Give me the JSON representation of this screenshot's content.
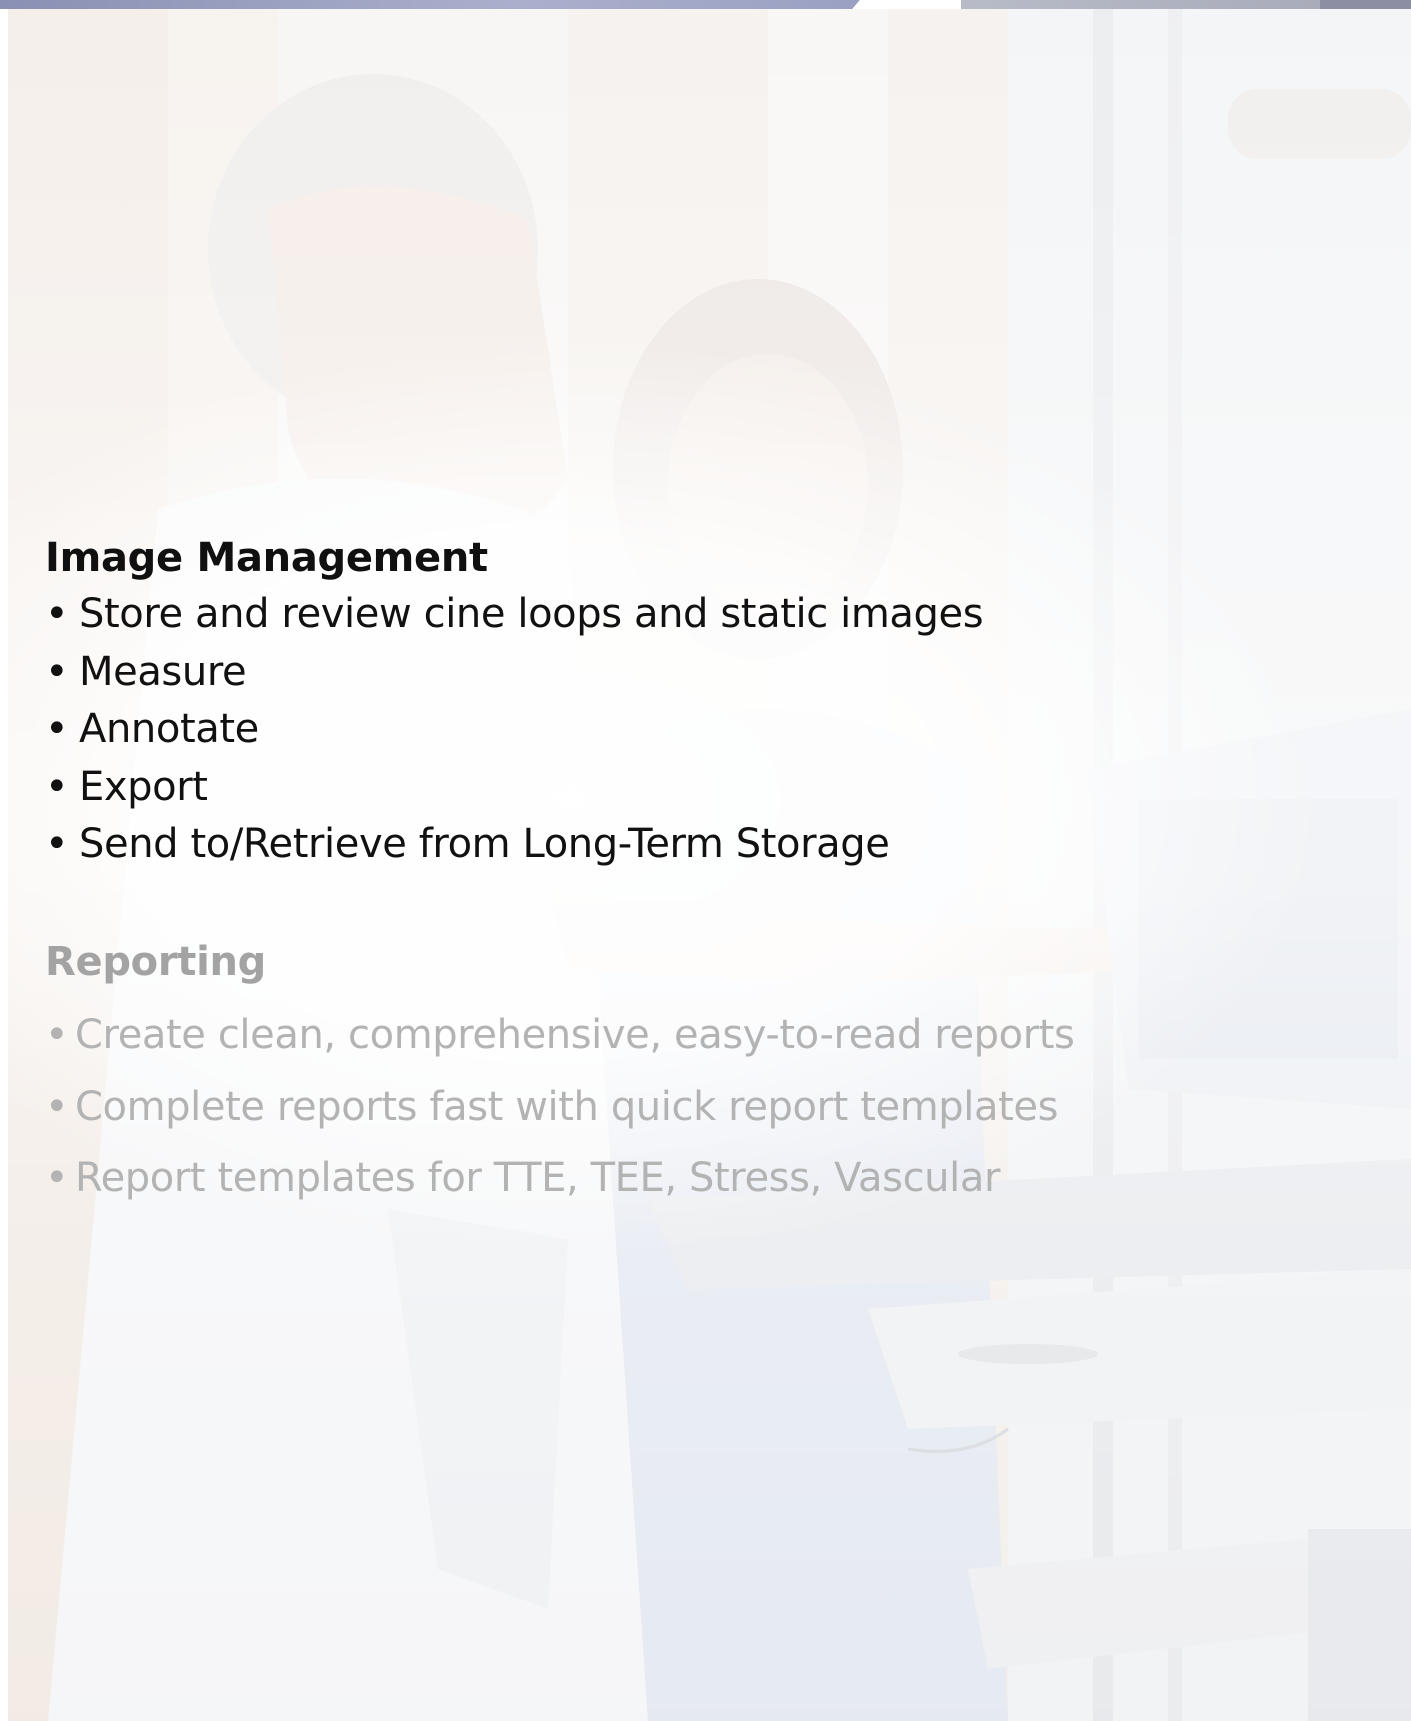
{
  "colors": {
    "top_strip_left": "#9aa0c2",
    "top_strip_right": "#a9acba",
    "heading_dark": "#101010",
    "text_dark": "#111111",
    "heading_faded": "#a3a3a3",
    "text_faded": "#b3b3b3"
  },
  "bullet_glyph": "•",
  "image_management": {
    "title": "Image Management",
    "items": [
      "Store and review cine loops and static images",
      "Measure",
      "Annotate",
      "Export",
      "Send to/Retrieve from Long-Term Storage"
    ]
  },
  "reporting": {
    "title": "Reporting",
    "items": [
      "Create clean, comprehensive, easy-to-read reports",
      "Complete reports fast with quick report templates",
      "Report templates for TTE, TEE, Stress, Vascular"
    ]
  }
}
